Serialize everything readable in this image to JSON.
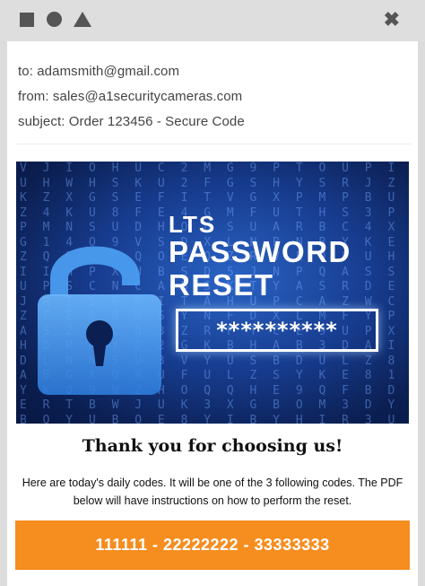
{
  "window": {
    "controls": [
      "square-icon",
      "circle-icon",
      "triangle-icon"
    ],
    "close_glyph": "✖"
  },
  "email": {
    "to": "to: adamsmith@gmail.com",
    "from": "from: sales@a1securitycameras.com",
    "subject": "subject: Order 123456 - Secure Code"
  },
  "banner": {
    "line1": "LTS",
    "line2": "PASSWORD",
    "line3": "RESET",
    "masked_password": "**********"
  },
  "body": {
    "heading": "Thank you for choosing us!",
    "description": "Here are today's daily codes. It will be one of the 3 following codes. The PDF below will have instructions on how to perform the reset.",
    "codes": "111111 - 22222222 - 33333333"
  },
  "colors": {
    "accent": "#f68d1f",
    "banner_blue": "#173c8f",
    "lock_blue": "#4a9cf0"
  }
}
